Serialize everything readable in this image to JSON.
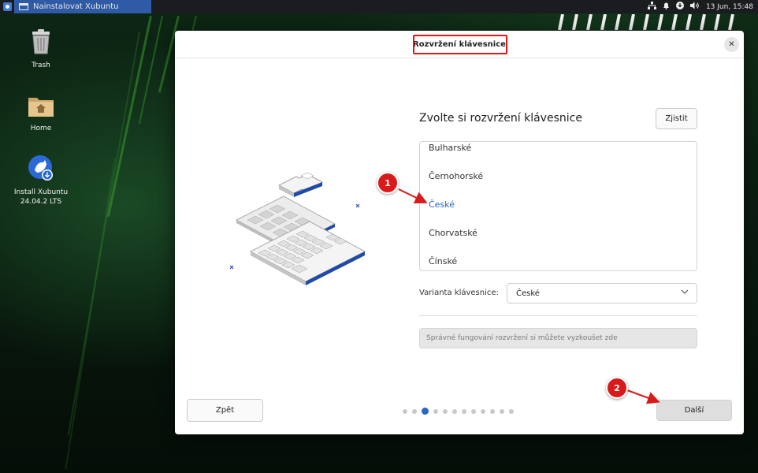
{
  "panel": {
    "task_title": "Nainstalovat Xubuntu",
    "clock": "13 Jun, 15:48",
    "icons": [
      "xfce-menu-icon",
      "network-icon",
      "bell-icon",
      "update-icon",
      "volume-icon"
    ]
  },
  "desktop": {
    "icons": [
      {
        "label": "Trash",
        "icon": "trash-icon"
      },
      {
        "label": "Home",
        "icon": "home-folder-icon"
      },
      {
        "label": "Install Xubuntu 24.04.2 LTS",
        "icon": "installer-icon"
      }
    ]
  },
  "window": {
    "title": "Rozvržení klávesnice",
    "heading": "Zvolte si rozvržení klávesnice",
    "detect_label": "Zjistit",
    "layouts": [
      "Bulharské",
      "Černohorské",
      "České",
      "Chorvatské",
      "Čínské"
    ],
    "selected_layout": "České",
    "variant_label": "Varianta klávesnice:",
    "variant_value": "České",
    "test_placeholder": "Správné fungování rozvržení si můžete vyzkoušet zde",
    "back_label": "Zpět",
    "next_label": "Další",
    "progress": {
      "total_steps": 12,
      "current_step": 3
    }
  },
  "annotations": {
    "badge1": "1",
    "badge2": "2",
    "color": "#d81a1a"
  },
  "colors": {
    "accent": "#2b67c6",
    "panel_task": "#2e5aa6",
    "desktop_green": "#3a9a2e"
  }
}
